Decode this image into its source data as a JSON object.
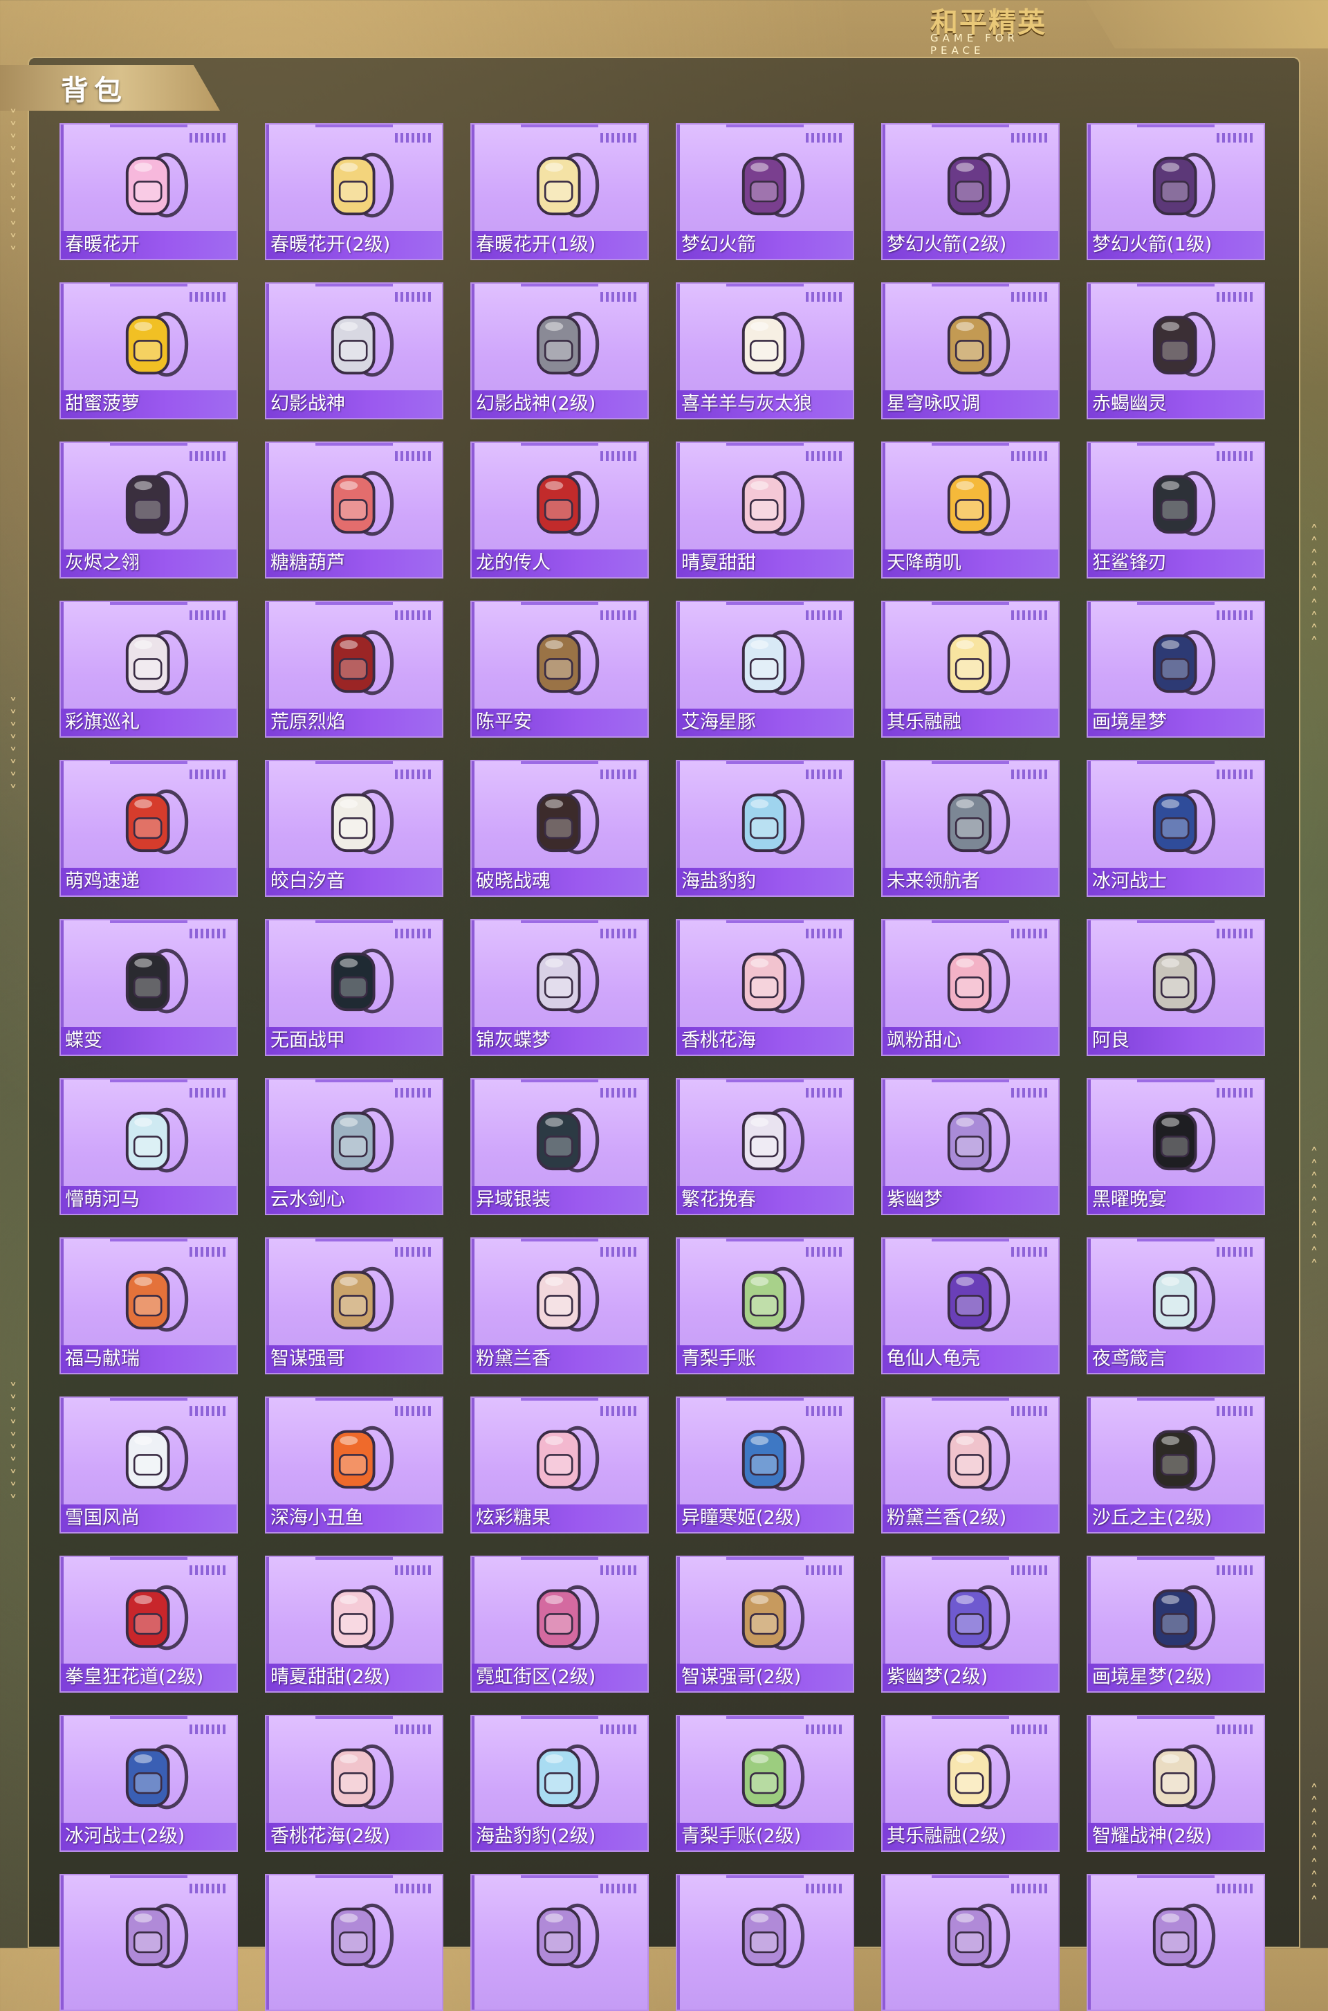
{
  "brand": {
    "logo_text": "和平精英",
    "logo_subtitle": "GAME FOR PEACE"
  },
  "panel": {
    "tab_label": "背包"
  },
  "icon_names": {
    "card": "backpack-icon",
    "side_arrows": "chevron-icon"
  },
  "colors": {
    "card_bg": "#d7b3ff",
    "label_bar": "#8c4ce3",
    "frame": "#ebcd8c"
  },
  "items": [
    {
      "name": "春暖花开",
      "color": "#f7b8dc"
    },
    {
      "name": "春暖花开(2级)",
      "color": "#f3d47c"
    },
    {
      "name": "春暖花开(1级)",
      "color": "#f4e2a5"
    },
    {
      "name": "梦幻火箭",
      "color": "#7a3f8f"
    },
    {
      "name": "梦幻火箭(2级)",
      "color": "#6a3a88"
    },
    {
      "name": "梦幻火箭(1级)",
      "color": "#5c3878"
    },
    {
      "name": "甜蜜菠萝",
      "color": "#f1c024"
    },
    {
      "name": "幻影战神",
      "color": "#d8d8e2"
    },
    {
      "name": "幻影战神(2级)",
      "color": "#8a8a96"
    },
    {
      "name": "喜羊羊与灰太狼",
      "color": "#f6efe3"
    },
    {
      "name": "星穹咏叹调",
      "color": "#c39a53"
    },
    {
      "name": "赤蝎幽灵",
      "color": "#3b2f35"
    },
    {
      "name": "灰烬之翎",
      "color": "#3a2f3e"
    },
    {
      "name": "糖糖葫芦",
      "color": "#e36d6d"
    },
    {
      "name": "龙的传人",
      "color": "#c22b2b"
    },
    {
      "name": "晴夏甜甜",
      "color": "#f4c8d6"
    },
    {
      "name": "天降萌叽",
      "color": "#f5b93a"
    },
    {
      "name": "狂鲨锋刃",
      "color": "#2d3138"
    },
    {
      "name": "彩旗巡礼",
      "color": "#ece3ea"
    },
    {
      "name": "荒原烈焰",
      "color": "#9b2525"
    },
    {
      "name": "陈平安",
      "color": "#9a7346"
    },
    {
      "name": "艾海星豚",
      "color": "#d8e9f6"
    },
    {
      "name": "其乐融融",
      "color": "#f8e4a0"
    },
    {
      "name": "画境星梦",
      "color": "#2d3a74"
    },
    {
      "name": "萌鸡速递",
      "color": "#d63c2c"
    },
    {
      "name": "皎白汐音",
      "color": "#f0ede6"
    },
    {
      "name": "破晓战魂",
      "color": "#3c2b2b"
    },
    {
      "name": "海盐豹豹",
      "color": "#9fd4ee"
    },
    {
      "name": "未来领航者",
      "color": "#7c8795"
    },
    {
      "name": "冰河战士",
      "color": "#2f4c9a"
    },
    {
      "name": "蝶变",
      "color": "#2a2a30"
    },
    {
      "name": "无面战甲",
      "color": "#1f2a33"
    },
    {
      "name": "锦灰蝶梦",
      "color": "#d8d0e6"
    },
    {
      "name": "香桃花海",
      "color": "#f2c3cf"
    },
    {
      "name": "飒粉甜心",
      "color": "#f3b2c6"
    },
    {
      "name": "阿良",
      "color": "#c8c4bb"
    },
    {
      "name": "懵萌河马",
      "color": "#cfeaf2"
    },
    {
      "name": "云水剑心",
      "color": "#9db2c2"
    },
    {
      "name": "异域银装",
      "color": "#2c3a44"
    },
    {
      "name": "繁花挽春",
      "color": "#e9e3f0"
    },
    {
      "name": "紫幽梦",
      "color": "#a98bd8"
    },
    {
      "name": "黑曜晚宴",
      "color": "#1e1e22"
    },
    {
      "name": "福马献瑞",
      "color": "#e4723a"
    },
    {
      "name": "智谋强哥",
      "color": "#caa36a"
    },
    {
      "name": "粉黛兰香",
      "color": "#f2d7dc"
    },
    {
      "name": "青梨手账",
      "color": "#a8d18a"
    },
    {
      "name": "龟仙人龟壳",
      "color": "#6a3fb8"
    },
    {
      "name": "夜鸢箴言",
      "color": "#cfe6ea"
    },
    {
      "name": "雪国风尚",
      "color": "#eef1f6"
    },
    {
      "name": "深海小丑鱼",
      "color": "#ef6a2b"
    },
    {
      "name": "炫彩糖果",
      "color": "#f3b8cf"
    },
    {
      "name": "异瞳寒姬(2级)",
      "color": "#3e78c4"
    },
    {
      "name": "粉黛兰香(2级)",
      "color": "#f0c3cc"
    },
    {
      "name": "沙丘之主(2级)",
      "color": "#2d2a25"
    },
    {
      "name": "拳皇狂花道(2级)",
      "color": "#c8262b"
    },
    {
      "name": "晴夏甜甜(2级)",
      "color": "#f5cbd7"
    },
    {
      "name": "霓虹街区(2级)",
      "color": "#d46aa0"
    },
    {
      "name": "智谋强哥(2级)",
      "color": "#c79a5e"
    },
    {
      "name": "紫幽梦(2级)",
      "color": "#6f5ad0"
    },
    {
      "name": "画境星梦(2级)",
      "color": "#2a3670"
    },
    {
      "name": "冰河战士(2级)",
      "color": "#3a5fb4"
    },
    {
      "name": "香桃花海(2级)",
      "color": "#f1c4cc"
    },
    {
      "name": "海盐豹豹(2级)",
      "color": "#a9dcf2"
    },
    {
      "name": "青梨手账(2级)",
      "color": "#9ccd7f"
    },
    {
      "name": "其乐融融(2级)",
      "color": "#f8e6b0"
    },
    {
      "name": "智耀战神(2级)",
      "color": "#eadcc2"
    }
  ]
}
